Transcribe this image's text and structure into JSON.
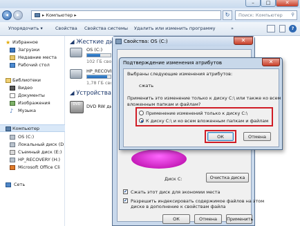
{
  "explorer": {
    "address": "Компьютер",
    "search_placeholder": "Поиск: Компьютер",
    "toolbar": {
      "organize": "Упорядочить ▾",
      "properties": "Свойства",
      "system_properties": "Свойства системы",
      "uninstall": "Удалить или изменить программу",
      "more": "»"
    },
    "nav": {
      "favorites": "Избранное",
      "downloads": "Загрузки",
      "recent": "Недавние места",
      "desktop": "Рабочий стол",
      "libraries": "Библиотеки",
      "video": "Видео",
      "documents": "Документы",
      "images": "Изображения",
      "music": "Музыка",
      "computer": "Компьютер",
      "os_c": "OS (C:)",
      "local_d": "Локальный диск (D",
      "removable_e": "Съемный диск (E:)",
      "hp_recovery": "HP_RECOVERY (H:)",
      "office": "Microsoft Office Cli",
      "network": "Сеть"
    },
    "content": {
      "hard_disks": "Жесткие диски (",
      "os_c": "OS (C:)",
      "os_c_free": "102 ГБ свобо",
      "hp_recovery": "HP_RECOVERY",
      "hp_recovery_free": "1,78 ГБ свобо",
      "removable": "Устройства со с",
      "dvd": "DVD RW диск",
      "dvd_icon_text": "DVD"
    },
    "os_c_usage": 0.55,
    "hp_recovery_usage": 0.85
  },
  "properties": {
    "title": "Свойства: OS (C:)",
    "drive_label": "Диск C:",
    "cleanup_button": "Очистка диска",
    "compress": "Сжать этот диск для экономии места",
    "index_line1": "Разрешить индексировать содержимое файлов на этом",
    "index_line2": "диске в дополнение к свойствам файла",
    "compress_checked": true,
    "index_checked": true,
    "ok": "ОК",
    "cancel": "Отмена",
    "apply": "Применить"
  },
  "dialog": {
    "title": "Подтверждение изменения атрибутов",
    "intro": "Выбраны следующие изменения атрибутов:",
    "change": "сжать",
    "question_line1": "Применить это изменение только к диску C:\\ или также ко всем",
    "question_line2": "вложенным папкам и файлам?",
    "option_only": "Применение изменений только к диску C:\\",
    "option_all": "К диску C:\\ и ко всем вложенным папкам и файлам",
    "selected": "option_all",
    "ok": "ОК",
    "cancel": "Отмена"
  },
  "colors": {
    "highlight": "#d01c25",
    "pie": "#d400c6",
    "explorer_toolbar": "#dde7f2"
  }
}
